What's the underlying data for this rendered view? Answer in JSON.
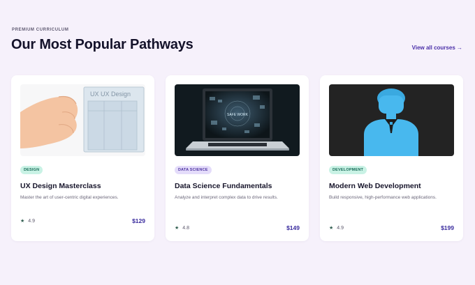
{
  "header": {
    "eyebrow": "PREMIUM CURRICULUM",
    "title": "Our Most Popular Pathways",
    "view_all": "View all courses →"
  },
  "courses": [
    {
      "category": "DESIGN",
      "title": "UX Design Masterclass",
      "description": "Master the art of user-centric digital experiences.",
      "rating": "4.9",
      "price": "$129",
      "thumb_text": "UX UX Design"
    },
    {
      "category": "DATA SCIENCE",
      "title": "Data Science Fundamentals",
      "description": "Analyze and interpret complex data to drive results.",
      "rating": "4.8",
      "price": "$149",
      "thumb_text": "SAFE WORK"
    },
    {
      "category": "DEVELOPMENT",
      "title": "Modern Web Development",
      "description": "Build responsive, high-performance web applications.",
      "rating": "4.9",
      "price": "$199"
    }
  ],
  "icons": {
    "rating": "star-icon"
  },
  "colors": {
    "accent": "#4a2fa8",
    "background": "#f6f1fb"
  }
}
